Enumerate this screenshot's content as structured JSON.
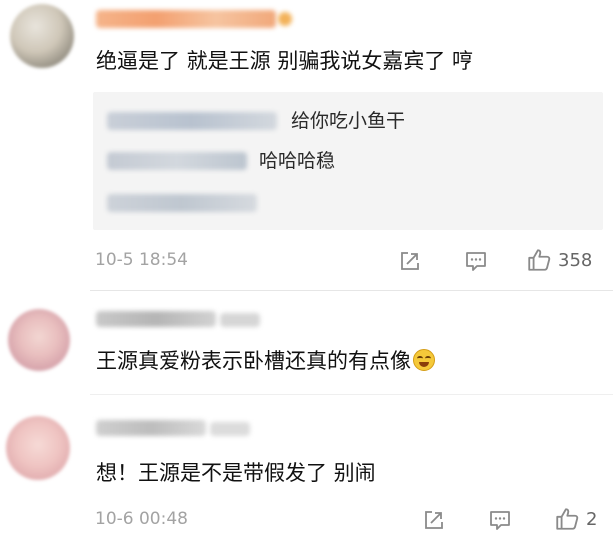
{
  "comments": [
    {
      "text": "绝逼是了 就是王源 别骗我说女嘉宾了 哼",
      "replies": [
        {
          "text": "给你吃小鱼干"
        },
        {
          "text": "哈哈哈稳"
        },
        {
          "text": ""
        }
      ],
      "timestamp": "10-5 18:54",
      "like_count": "358"
    },
    {
      "text": "王源真爱粉表示卧槽还真的有点像",
      "emoji": "laughing-crying-emoji"
    },
    {
      "text": "想！王源是不是带假发了 别闹",
      "timestamp": "10-6 00:48",
      "like_count": "2"
    }
  ],
  "colors": {
    "meta_gray": "#a3a3a3",
    "reply_bg": "#f4f4f4",
    "icon_gray": "#8a8a8a"
  },
  "icons": {
    "share": "share-icon",
    "reply": "comment-icon",
    "like": "thumbs-up-icon"
  }
}
